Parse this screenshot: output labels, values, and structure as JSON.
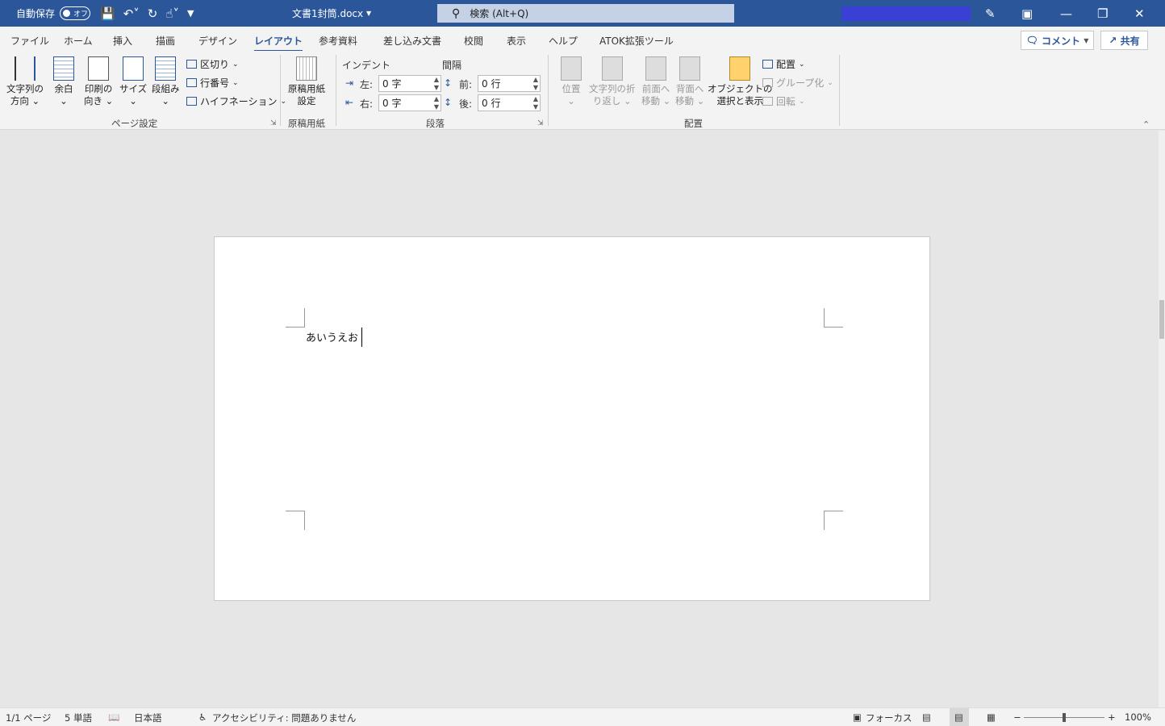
{
  "titlebar": {
    "autosave_label": "自動保存",
    "autosave_state": "オフ",
    "doc_title": "文書1封筒.docx",
    "search_placeholder": "検索 (Alt+Q)",
    "qat_icons": [
      "save-icon",
      "undo-icon",
      "redo-icon",
      "touch-icon",
      "customize-icon"
    ]
  },
  "tabs": [
    "ファイル",
    "ホーム",
    "挿入",
    "描画",
    "デザイン",
    "レイアウト",
    "参考資料",
    "差し込み文書",
    "校閲",
    "表示",
    "ヘルプ",
    "ATOK拡張ツール"
  ],
  "active_tab": "レイアウト",
  "comment_button": "コメント",
  "share_button": "共有",
  "ribbon": {
    "page_setup": {
      "label": "ページ設定",
      "text_direction": [
        "文字列の",
        "方向"
      ],
      "margins": "余白",
      "orientation": [
        "印刷の",
        "向き"
      ],
      "size": "サイズ",
      "columns": "段組み",
      "breaks": "区切り",
      "line_numbers": "行番号",
      "hyphenation": "ハイフネーション"
    },
    "manuscript": {
      "label": "原稿用紙",
      "settings": [
        "原稿用紙",
        "設定"
      ]
    },
    "paragraph": {
      "label": "段落",
      "indent_header": "インデント",
      "spacing_header": "間隔",
      "indent_left_label": "左:",
      "indent_left_value": "0 字",
      "indent_right_label": "右:",
      "indent_right_value": "0 字",
      "spacing_before_label": "前:",
      "spacing_before_value": "0 行",
      "spacing_after_label": "後:",
      "spacing_after_value": "0 行"
    },
    "arrange": {
      "label": "配置",
      "position": "位置",
      "wrap_text": [
        "文字列の折",
        "り返し"
      ],
      "bring_forward": [
        "前面へ",
        "移動"
      ],
      "send_backward": [
        "背面へ",
        "移動"
      ],
      "selection_pane": [
        "オブジェクトの",
        "選択と表示"
      ],
      "align": "配置",
      "group": "グループ化",
      "rotate": "回転"
    }
  },
  "document": {
    "text": "あいうえお"
  },
  "statusbar": {
    "page": "1/1 ページ",
    "words": "5 単語",
    "language": "日本語",
    "accessibility": "アクセシビリティ: 問題ありません",
    "focus": "フォーカス",
    "zoom": "100%"
  }
}
